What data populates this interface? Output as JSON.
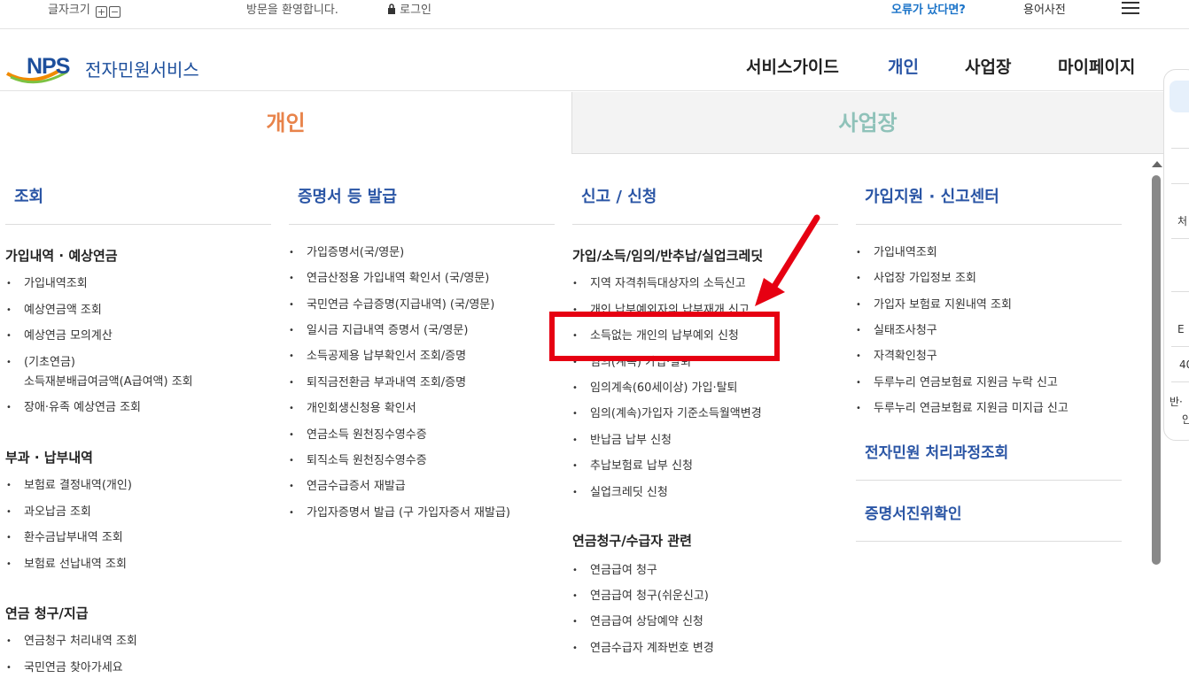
{
  "topbar": {
    "font_size_label": "글자크기",
    "plus": "+",
    "minus": "−",
    "welcome": "방문을 환영합니다.",
    "login": "로그인",
    "error_report": "오류가 났다면?",
    "glossary": "용어사전"
  },
  "header": {
    "logo_text": "NPS",
    "service_name": "전자민원서비스",
    "nav": [
      "서비스가이드",
      "개인",
      "사업장",
      "마이페이지"
    ]
  },
  "tabs": {
    "personal": "개인",
    "business": "사업장"
  },
  "col1": {
    "title": "조회",
    "sec1": "가입내역 · 예상연금",
    "sec1_items": [
      "가입내역조회",
      "예상연금액 조회",
      "예상연금 모의계산",
      "(기초연금)",
      "소득재분배급여금액(A급여액) 조회",
      "장애·유족 예상연금 조회"
    ],
    "sec2": "부과 · 납부내역",
    "sec2_items": [
      "보험료 결정내역(개인)",
      "과오납금 조회",
      "환수금납부내역 조회",
      "보험료 선납내역 조회"
    ],
    "sec3": "연금 청구/지급",
    "sec3_items": [
      "연금청구 처리내역 조회",
      "국민연금 찾아가세요"
    ]
  },
  "col2": {
    "title": "증명서 등 발급",
    "items": [
      "가입증명서(국/영문)",
      "연금산정용 가입내역 확인서 (국/영문)",
      "국민연금 수급증명(지급내역) (국/영문)",
      "일시금 지급내역 증명서 (국/영문)",
      "소득공제용 납부확인서 조회/증명",
      "퇴직금전환금 부과내역 조회/증명",
      "개인회생신청용 확인서",
      "연금소득 원천징수영수증",
      "퇴직소득 원천징수영수증",
      "연금수급증서 재발급",
      "가입자증명서 발급 (구 가입자증서 재발급)"
    ]
  },
  "col3": {
    "title": "신고 / 신청",
    "sec1": "가입/소득/임의/반추납/실업크레딧",
    "sec1_items": [
      "지역 자격취득대상자의 소득신고",
      "개인 납부예외자의 납부재개 신고",
      "소득없는 개인의 납부예외 신청",
      "임의(계속) 가입·탈퇴",
      "임의계속(60세이상) 가입·탈퇴",
      "임의(계속)가입자 기준소득월액변경",
      "반납금 납부 신청",
      "추납보험료 납부 신청",
      "실업크레딧 신청"
    ],
    "sec2": "연금청구/수급자 관련",
    "sec2_items": [
      "연금급여 청구",
      "연금급여 청구(쉬운신고)",
      "연금급여 상담예약 신청",
      "연금수급자 계좌번호 변경"
    ]
  },
  "col4": {
    "title": "가입지원 · 신고센터",
    "items": [
      "가입내역조회",
      "사업장 가입정보 조회",
      "가입자 보험료 지원내역 조회",
      "실태조사청구",
      "자격확인청구",
      "두루누리 연금보험료 지원금 누락 신고",
      "두루누리 연금보험료 지원금 미지급 신고"
    ],
    "link1": "전자민원 처리과정조회",
    "link2": "증명서진위확인"
  },
  "sidepanel": {
    "fragments": [
      "처",
      "Ε",
      "40",
      "반·",
      "안"
    ]
  },
  "colors": {
    "accent_blue": "#2a55a5",
    "personal_orange": "#e8834a",
    "business_teal": "#8fc2b9",
    "highlight_red": "#e60012"
  }
}
